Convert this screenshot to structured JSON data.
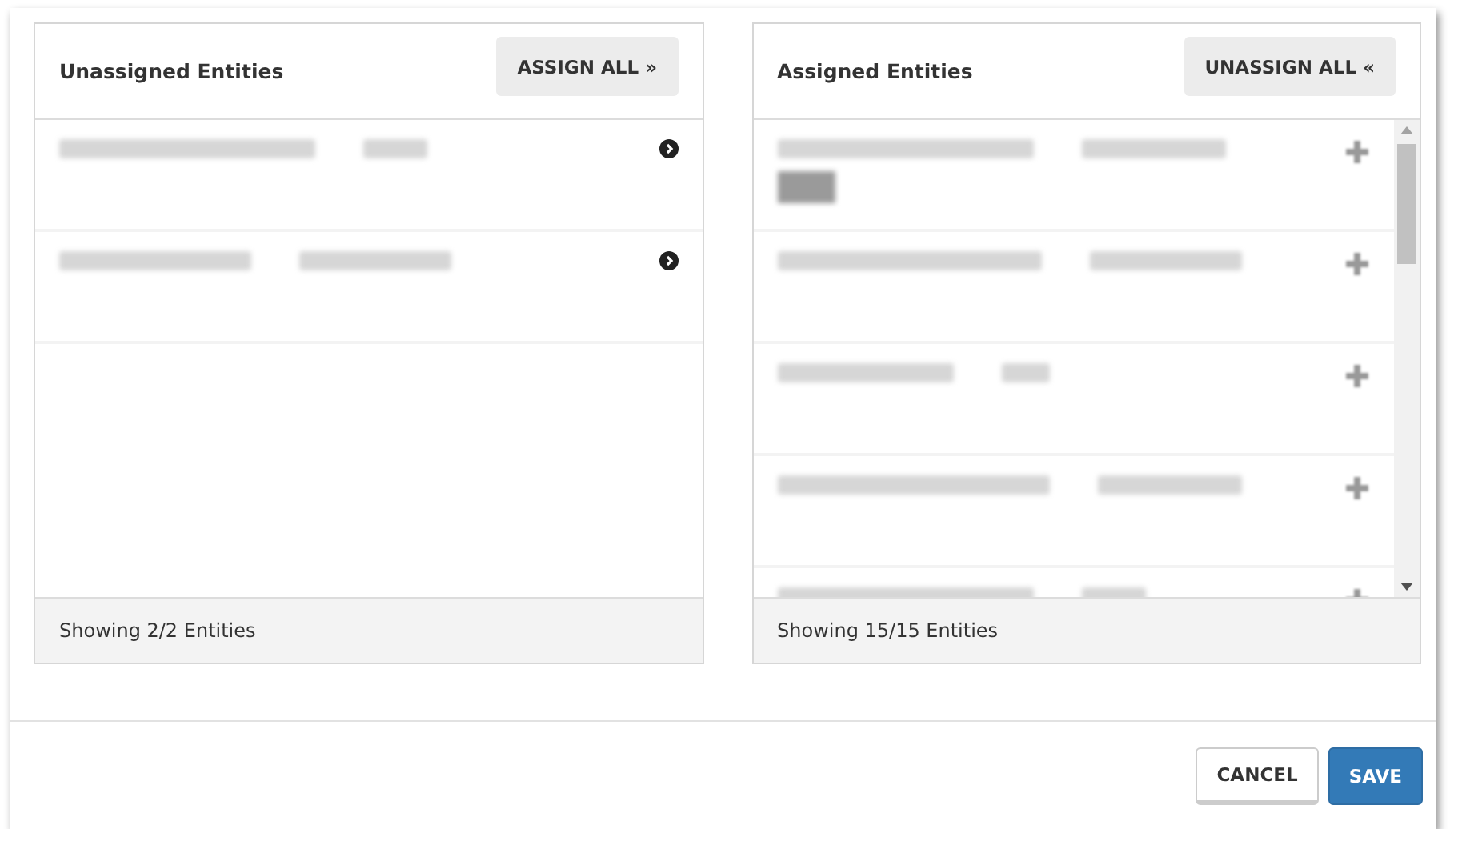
{
  "panels": [
    {
      "title": "Unassigned Entities",
      "action": {
        "label": "ASSIGN ALL",
        "glyph": "»"
      },
      "rows": [
        {
          "kind": "assign"
        },
        {
          "kind": "assign"
        }
      ],
      "scrollbar": false,
      "footer": "Showing 2/2 Entities"
    },
    {
      "title": "Assigned Entities",
      "action": {
        "label": "UNASSIGN ALL",
        "glyph": "«"
      },
      "rows": [
        {
          "kind": "unassign",
          "tag": true
        },
        {
          "kind": "unassign"
        },
        {
          "kind": "unassign"
        },
        {
          "kind": "unassign"
        },
        {
          "kind": "unassign"
        }
      ],
      "scrollbar": true,
      "footer": "Showing 15/15 Entities"
    }
  ],
  "buttons": [
    {
      "label": "CANCEL",
      "kind": "secondary"
    },
    {
      "label": "SAVE",
      "kind": "primary"
    }
  ]
}
